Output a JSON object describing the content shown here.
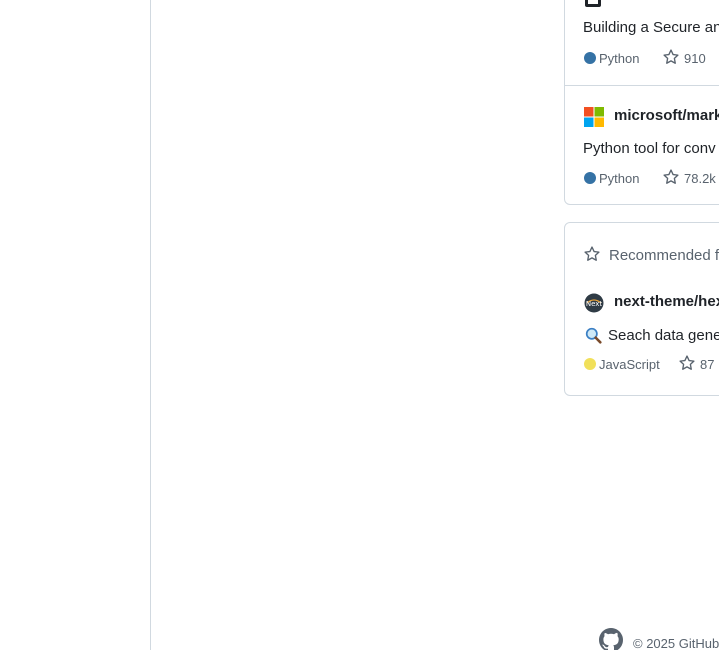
{
  "repos_top": [
    {
      "name": "",
      "description": "Building a Secure an",
      "language": "Python",
      "language_color": "#3572A5",
      "stars": "910"
    },
    {
      "name": "microsoft/mark",
      "description": "Python tool for conv",
      "language": "Python",
      "language_color": "#3572A5",
      "stars": "78.2k"
    }
  ],
  "recommended": {
    "heading": "Recommended f",
    "repo": {
      "name": "next-theme/hex",
      "description": "Seach data gene",
      "language": "JavaScript",
      "language_color": "#f1e05a",
      "stars": "87"
    }
  },
  "footer": {
    "copyright": "© 2025 GitHub"
  },
  "icons": {
    "owner_icon_top": "repo-owner-icon",
    "microsoft_logo": "microsoft-logo-icon",
    "star": "star-icon",
    "next_logo": "next-theme-logo-icon",
    "magnifier": "magnifying-glass-icon",
    "github": "github-mark-icon"
  }
}
